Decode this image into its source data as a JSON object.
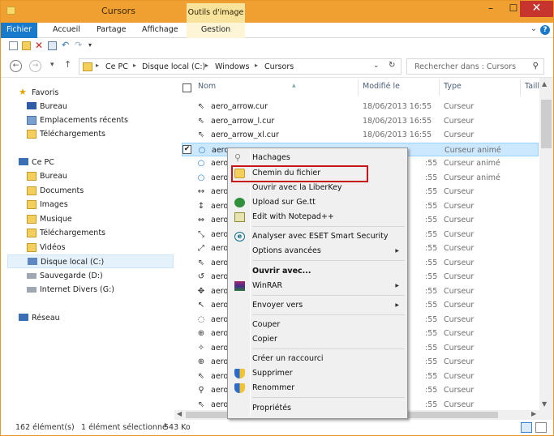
{
  "window": {
    "title": "Cursors",
    "tools_tab": "Outils d'image",
    "minimize": "–",
    "maximize": "☐",
    "close": "✕"
  },
  "ribbon": {
    "file": "Fichier",
    "tabs": [
      "Accueil",
      "Partage",
      "Affichage"
    ],
    "gestion": "Gestion"
  },
  "address": {
    "crumbs": [
      "Ce PC",
      "Disque local (C:)",
      "Windows",
      "Cursors"
    ],
    "search_placeholder": "Rechercher dans : Cursors"
  },
  "navpane": {
    "favorites": "Favoris",
    "fav_items": [
      "Bureau",
      "Emplacements récents",
      "Téléchargements"
    ],
    "this_pc": "Ce PC",
    "pc_items": [
      "Bureau",
      "Documents",
      "Images",
      "Musique",
      "Téléchargements",
      "Vidéos",
      "Disque local (C:)",
      "Sauvegarde (D:)",
      "Internet Divers (G:)"
    ],
    "network": "Réseau"
  },
  "columns": {
    "name": "Nom",
    "modified": "Modifié le",
    "type": "Type",
    "size": "Taille"
  },
  "files": [
    {
      "name": "aero_arrow.cur",
      "date": "18/06/2013 16:55",
      "type": "Curseur"
    },
    {
      "name": "aero_arrow_l.cur",
      "date": "18/06/2013 16:55",
      "type": "Curseur"
    },
    {
      "name": "aero_arrow_xl.cur",
      "date": "18/06/2013 16:55",
      "type": "Curseur"
    },
    {
      "name": "aero_",
      "date": "",
      "type": "Curseur animé"
    },
    {
      "name": "aero_",
      "date": ":55",
      "type": "Curseur animé"
    },
    {
      "name": "aero_",
      "date": ":55",
      "type": "Curseur animé"
    },
    {
      "name": "aero_",
      "date": ":55",
      "type": "Curseur"
    },
    {
      "name": "aero_",
      "date": ":55",
      "type": "Curseur"
    },
    {
      "name": "aero_",
      "date": ":55",
      "type": "Curseur"
    },
    {
      "name": "aero_",
      "date": ":55",
      "type": "Curseur"
    },
    {
      "name": "aero_",
      "date": ":55",
      "type": "Curseur"
    },
    {
      "name": "aero_",
      "date": ":55",
      "type": "Curseur"
    },
    {
      "name": "aero_",
      "date": ":55",
      "type": "Curseur"
    },
    {
      "name": "aero_",
      "date": ":55",
      "type": "Curseur"
    },
    {
      "name": "aero_",
      "date": ":55",
      "type": "Curseur"
    },
    {
      "name": "aero_",
      "date": ":55",
      "type": "Curseur"
    },
    {
      "name": "aero_",
      "date": ":55",
      "type": "Curseur"
    },
    {
      "name": "aero_",
      "date": ":55",
      "type": "Curseur"
    },
    {
      "name": "aero_",
      "date": ":55",
      "type": "Curseur"
    },
    {
      "name": "aero_",
      "date": ":55",
      "type": "Curseur"
    },
    {
      "name": "aero_",
      "date": ":55",
      "type": "Curseur"
    },
    {
      "name": "aero_",
      "date": ":55",
      "type": "Curseur"
    },
    {
      "name": "aero_",
      "date": ":55",
      "type": "Curseur"
    }
  ],
  "context_menu": {
    "items": [
      "Hachages",
      "Chemin du fichier",
      "Ouvrir avec la LiberKey",
      "Upload sur Ge.tt",
      "Edit with Notepad++",
      "Analyser avec ESET Smart Security",
      "Options avancées",
      "Ouvrir avec...",
      "WinRAR",
      "Envoyer vers",
      "Couper",
      "Copier",
      "Créer un raccourci",
      "Supprimer",
      "Renommer",
      "Propriétés"
    ]
  },
  "status": {
    "count": "162 élément(s)",
    "selected": "1 élément sélectionné",
    "size": "543 Ko"
  },
  "colors": {
    "titlebar": "#f0a030",
    "file_tab": "#1979ca",
    "highlight": "#c8161d"
  }
}
